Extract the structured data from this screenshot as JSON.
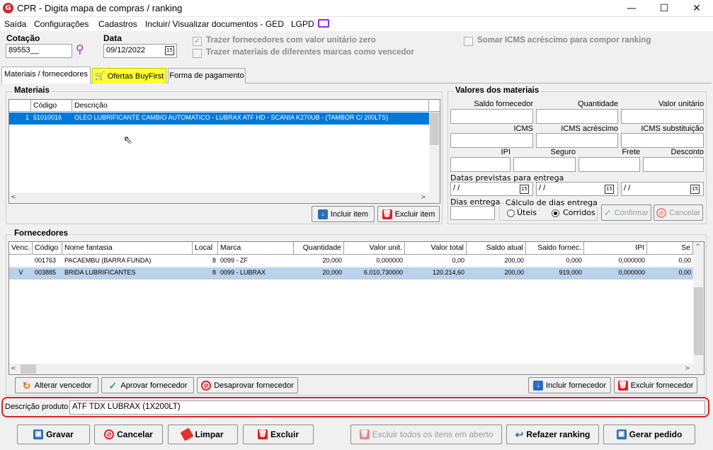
{
  "window": {
    "title": "CPR - Digita mapa de compras / ranking",
    "app_icon": "G",
    "minimize": "—",
    "maximize": "☐",
    "close": "✕"
  },
  "menu": [
    "Saída",
    "Configurações",
    "Cadastros",
    "Incluir/ Visualizar documentos - GED",
    "LGPD"
  ],
  "header": {
    "cotacao_label": "Cotação",
    "cotacao_value": "89553__",
    "data_label": "Data",
    "data_value": "09/12/2022",
    "calendar_icon_text": "15",
    "check_fornecedores": "Trazer fornecedores com valor unitário zero",
    "check_marcas": "Trazer materiais de diferentes marcas como vencedor",
    "check_icms": "Somar ICMS acréscimo para compor ranking"
  },
  "tabs": [
    "Materiais / fornecedores",
    "Ofertas BuyFirst",
    "Forma de pagamento"
  ],
  "materiais": {
    "legend": "Materiais",
    "columns": [
      "",
      "Código",
      "Descrição"
    ],
    "rows": [
      {
        "num": "1",
        "codigo": "51010016",
        "descricao": "OLEO LUBRIFICANTE CAMBIO AUTOMATICO - LUBRAX ATF HD - SCANIA K270UB - (TAMBOR C/ 200LTS)"
      }
    ],
    "btn_incluir": "Incluir item",
    "btn_excluir": "Excluir item"
  },
  "valores": {
    "legend": "Valores dos materiais",
    "saldo": "Saldo fornecedor",
    "quantidade": "Quantidade",
    "valor_unitario": "Valor unitário",
    "icms": "ICMS",
    "icms_acrescimo": "ICMS acréscimo",
    "icms_substituicao": "ICMS substituição",
    "ipi": "IPI",
    "seguro": "Seguro",
    "frete": "Frete",
    "desconto": "Desconto",
    "datas": "Datas previstas para entrega",
    "date_empty": " /  /",
    "dias": "Dias entrega",
    "calculo": "Cálculo de dias entrega",
    "uteis": "Úteis",
    "corridos": "Corridos",
    "confirmar": "Confirmar",
    "cancelar": "Cancelar"
  },
  "fornecedores": {
    "legend": "Fornecedores",
    "columns": [
      "Venc.",
      "Código",
      "Nome fantasia",
      "Local",
      "Marca",
      "Quantidade",
      "Valor unit.",
      "Valor total",
      "Saldo atual",
      "Saldo fornec.",
      "IPI",
      "Se"
    ],
    "rows": [
      {
        "venc": "",
        "codigo": "001763",
        "nome": "PACAEMBU (BARRA FUNDA)",
        "local": "8",
        "marca": "0099 - ZF",
        "quantidade": "20,000",
        "valor_unit": "0,000000",
        "valor_total": "0,00",
        "saldo_atual": "200,00",
        "saldo_fornec": "0,000",
        "ipi": "0,000000",
        "se": "0,00"
      },
      {
        "venc": "V",
        "codigo": "003885",
        "nome": "BRIDA LUBRIFICANTES",
        "local": "8",
        "marca": "0099 - LUBRAX",
        "quantidade": "20,000",
        "valor_unit": "6.010,730000",
        "valor_total": "120.214,60",
        "saldo_atual": "200,00",
        "saldo_fornec": "919,000",
        "ipi": "0,000000",
        "se": "0,00"
      }
    ],
    "btn_alterar": "Alterar vencedor",
    "btn_aprovar": "Aprovar fornecedor",
    "btn_desaprovar": "Desaprovar fornecedor",
    "btn_incluir": "Incluir fornecedor",
    "btn_excluir": "Excluir fornecedor"
  },
  "descricao": {
    "label": "Descrição produto",
    "value": "ATF TDX LUBRAX (1X200LT)"
  },
  "footer": {
    "gravar": "Gravar",
    "cancelar": "Cancelar",
    "limpar": "Limpar",
    "excluir": "Excluir",
    "excluir_todos": "Excluir todos os itens em aberto",
    "refazer": "Refazer ranking",
    "gerar": "Gerar pedido"
  },
  "colors": {
    "selection": "#0078d7",
    "selected_row": "#b9d1ea",
    "highlight_tab": "#ffff33",
    "annotation": "#e02020"
  }
}
